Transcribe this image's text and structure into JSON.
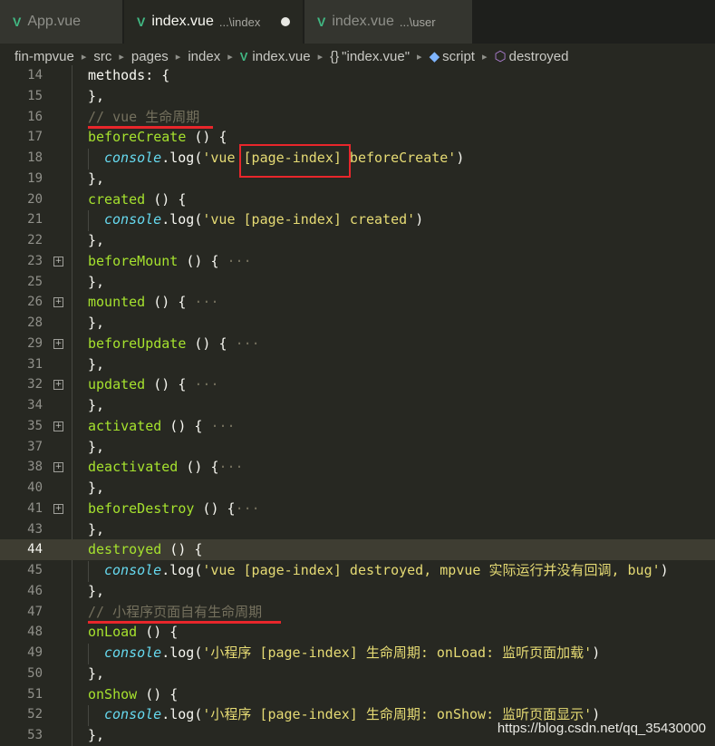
{
  "tabs": [
    {
      "icon": "vue-icon",
      "label": "App.vue",
      "path": "",
      "active": false,
      "dirty": false
    },
    {
      "icon": "vue-icon",
      "label": "index.vue",
      "path": "...\\index",
      "active": true,
      "dirty": true
    },
    {
      "icon": "vue-icon",
      "label": "index.vue",
      "path": "...\\user",
      "active": false,
      "dirty": false
    }
  ],
  "breadcrumb": {
    "items": [
      "fin-mpvue",
      "src",
      "pages",
      "index",
      "index.vue",
      "\"index.vue\"",
      "script",
      "destroyed"
    ],
    "icons": [
      "vue-icon",
      "braces-icon",
      "cube-icon",
      "symbol-icon"
    ]
  },
  "lines": [
    {
      "n": "14",
      "text": "methods: {"
    },
    {
      "n": "15",
      "text": "},"
    },
    {
      "n": "16",
      "comment": "// vue 生命周期"
    },
    {
      "n": "17",
      "fn": "beforeCreate",
      "rest": " () {"
    },
    {
      "n": "18",
      "console": "console",
      "log": ".log(",
      "str": "'vue [page-index] beforeCreate'",
      "tail": ")"
    },
    {
      "n": "19",
      "text": "},"
    },
    {
      "n": "20",
      "fn": "created",
      "rest": " () {"
    },
    {
      "n": "21",
      "console": "console",
      "log": ".log(",
      "str": "'vue [page-index] created'",
      "tail": ")"
    },
    {
      "n": "22",
      "text": "},"
    },
    {
      "n": "23",
      "fn": "beforeMount",
      "rest": " () { ",
      "dots": "···",
      "folded": true
    },
    {
      "n": "25",
      "text": "},"
    },
    {
      "n": "26",
      "fn": "mounted",
      "rest": " () { ",
      "dots": "···",
      "folded": true
    },
    {
      "n": "28",
      "text": "},"
    },
    {
      "n": "29",
      "fn": "beforeUpdate",
      "rest": " () { ",
      "dots": "···",
      "folded": true
    },
    {
      "n": "31",
      "text": "},"
    },
    {
      "n": "32",
      "fn": "updated",
      "rest": " () { ",
      "dots": "···",
      "folded": true
    },
    {
      "n": "34",
      "text": "},"
    },
    {
      "n": "35",
      "fn": "activated",
      "rest": " () { ",
      "dots": "···",
      "folded": true
    },
    {
      "n": "37",
      "text": "},"
    },
    {
      "n": "38",
      "fn": "deactivated",
      "rest": " () {",
      "dots": "···",
      "folded": true
    },
    {
      "n": "40",
      "text": "},"
    },
    {
      "n": "41",
      "fn": "beforeDestroy",
      "rest": " () {",
      "dots": "···",
      "folded": true
    },
    {
      "n": "43",
      "text": "},"
    },
    {
      "n": "44",
      "fn": "destroyed",
      "rest": " () {",
      "current": true
    },
    {
      "n": "45",
      "console": "console",
      "log": ".log(",
      "str": "'vue [page-index] destroyed, mpvue 实际运行并没有回调, bug'",
      "tail": ")"
    },
    {
      "n": "46",
      "text": "},"
    },
    {
      "n": "47",
      "comment": "// 小程序页面自有生命周期"
    },
    {
      "n": "48",
      "fn": "onLoad",
      "rest": " () {"
    },
    {
      "n": "49",
      "console": "console",
      "log": ".log(",
      "str": "'小程序 [page-index] 生命周期: onLoad: 监听页面加载'",
      "tail": ")"
    },
    {
      "n": "50",
      "text": "},"
    },
    {
      "n": "51",
      "fn": "onShow",
      "rest": " () {"
    },
    {
      "n": "52",
      "console": "console",
      "log": ".log(",
      "str": "'小程序 [page-index] 生命周期: onShow: 监听页面显示'",
      "tail": ")"
    },
    {
      "n": "53",
      "text": "},"
    }
  ],
  "watermark": "https://blog.csdn.net/qq_35430000",
  "colors": {
    "background": "#272822",
    "function": "#a6e22e",
    "string": "#e6db74",
    "object": "#66d9ef",
    "comment": "#75715e",
    "annotation": "#e8262b",
    "vue": "#41b883"
  }
}
